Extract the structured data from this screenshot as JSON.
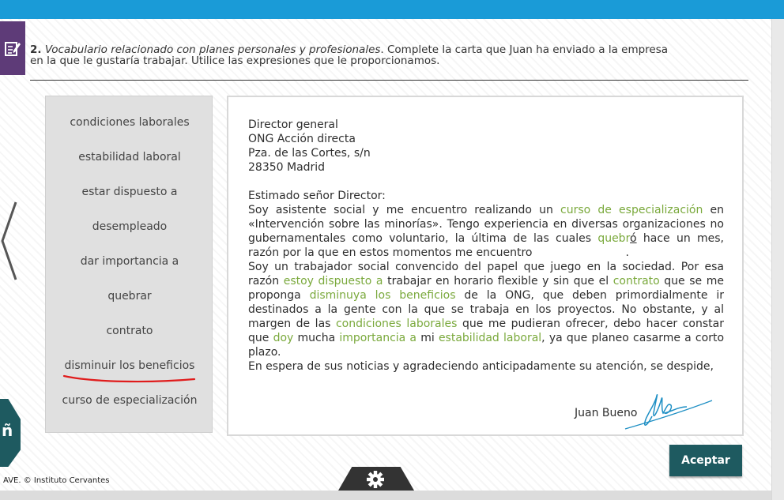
{
  "exercise": {
    "number": "2.",
    "subject": "Vocabulario relacionado con planes personales y profesionales",
    "instruction_line1": ". Complete la carta que Juan ha enviado a la empresa",
    "instruction_line2": "en la que le gustaría trabajar. Utilice las expresiones que le proporcionamos."
  },
  "word_bank": [
    "condiciones laborales",
    "estabilidad laboral",
    "estar dispuesto a",
    "desempleado",
    "dar importancia a",
    "quebrar",
    "contrato",
    "disminuir los beneficios",
    "curso de especialización"
  ],
  "letter": {
    "address": [
      "Director general",
      "ONG Acción directa",
      "Pza. de las Cortes, s/n",
      "28350 Madrid"
    ],
    "greeting": "Estimado señor Director:",
    "p1": {
      "a": "Soy asistente social y me encuentro realizando un ",
      "g1": "curso de especialización",
      "b": " en «Intervención sobre las minorías». Tengo experiencia en diversas organizaciones no gubernamentales como voluntario, la última de las cuales ",
      "g2": "quebr",
      "g2_end": "ó",
      "c": " hace un mes, razón por la que en estos momentos me encuentro",
      "end": "."
    },
    "p2": {
      "a": "Soy un trabajador social convencido del papel que juego en la sociedad. Por esa razón ",
      "g1": "estoy dispuesto a",
      "b": " trabajar en horario flexible y sin que el ",
      "g2": "contrato",
      "c": " que se me proponga ",
      "g3": "disminuya los beneficios",
      "d": " de la ONG, que deben primordialmente ir destinados a la gente con la que se trabaja en los proyectos. No obstante, y al margen de las ",
      "g4": "condiciones laborales",
      "e": " que me pudieran ofrecer, debo hacer constar que ",
      "g5": "doy",
      "f": " mucha ",
      "g6": "importancia a",
      "g": " mi ",
      "g7": "estabilidad laboral",
      "h": ", ya que planeo casarme a corto plazo."
    },
    "closing": "En espera de sus noticias y agradeciendo anticipadamente su atención, se despide,",
    "signature_name": "Juan Bueno"
  },
  "buttons": {
    "accept": "Aceptar"
  },
  "side_tab": {
    "letter": "ñ"
  },
  "footer": {
    "copyright": "AVE. © Instituto Cervantes"
  },
  "colors": {
    "top_bar": "#1a9bd7",
    "accent_green": "#7aa93c",
    "button": "#1e5a60",
    "badge": "#5e3b78"
  },
  "icons": [
    "edit-icon",
    "chevron-left-icon",
    "gear-icon",
    "signature-icon"
  ]
}
